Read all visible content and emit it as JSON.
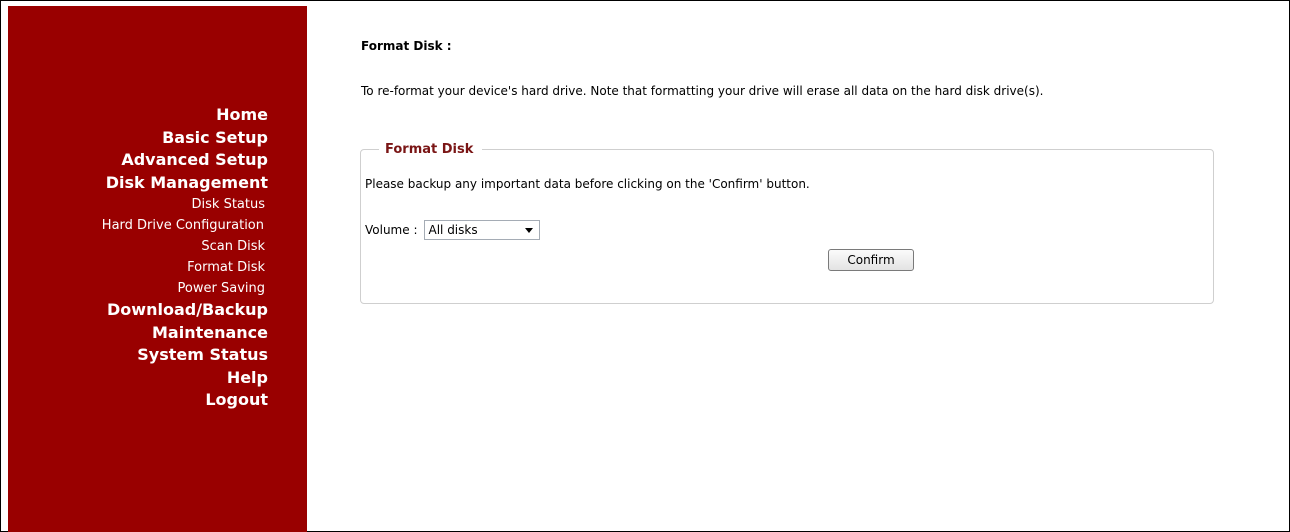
{
  "sidebar": {
    "items": [
      {
        "label": "Home",
        "level": "main"
      },
      {
        "label": "Basic Setup",
        "level": "main"
      },
      {
        "label": "Advanced Setup",
        "level": "main"
      },
      {
        "label": "Disk Management",
        "level": "main"
      },
      {
        "label": "Disk Status",
        "level": "sub"
      },
      {
        "label": "Hard Drive Configuration",
        "level": "sub"
      },
      {
        "label": "Scan Disk",
        "level": "sub"
      },
      {
        "label": "Format Disk",
        "level": "sub"
      },
      {
        "label": "Power Saving",
        "level": "sub"
      },
      {
        "label": "Download/Backup",
        "level": "main"
      },
      {
        "label": "Maintenance",
        "level": "main"
      },
      {
        "label": "System Status",
        "level": "main"
      },
      {
        "label": "Help",
        "level": "main"
      },
      {
        "label": "Logout",
        "level": "main"
      }
    ]
  },
  "main": {
    "title": "Format Disk :",
    "description": "To re-format your device's hard drive. Note that formatting your drive will erase all data on the hard disk drive(s).",
    "section": {
      "legend": "Format Disk",
      "warning": "Please backup any important data before clicking on the 'Confirm' button.",
      "volume_label": "Volume :",
      "volume_selected": "All disks",
      "confirm_label": "Confirm"
    }
  },
  "colors": {
    "sidebar_bg": "#990000",
    "legend_text": "#7a1515"
  },
  "icons": {
    "dropdown": "chevron-down-icon"
  }
}
